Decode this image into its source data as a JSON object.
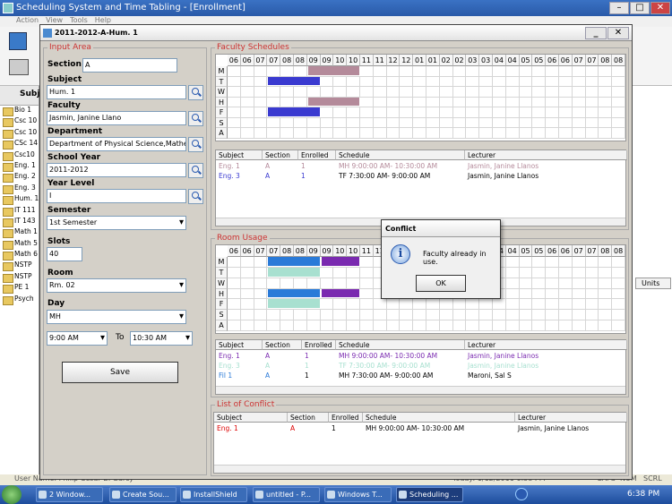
{
  "app": {
    "title": "Scheduling System and Time Tabling - [Enrollment]",
    "menus": [
      "Action",
      "View",
      "Tools",
      "Help"
    ],
    "status_left": "User Name: Philip Cesar B. Garcy",
    "status_right": "Today: 1/12/2011  6:38 PM",
    "caps": "CAPS",
    "num": "NUM",
    "scrl": "SCRL"
  },
  "leftnav": {
    "header": "Subj",
    "items": [
      "Bio 1",
      "Csc 10",
      "Csc 10",
      "CSc 14",
      "Csc10",
      "Eng. 1",
      "Eng. 2",
      "Eng. 3",
      "Hum. 1",
      "IT 111",
      "IT 143",
      "Math 1",
      "Math 5",
      "Math 6",
      "NSTP",
      "NSTP",
      "PE 1",
      "Psych"
    ]
  },
  "right_col_label": "Units",
  "window": {
    "title": "2011-2012-A-Hum. 1"
  },
  "input": {
    "caption": "Input Area",
    "section_label": "Section",
    "section": "A",
    "subject_label": "Subject",
    "subject": "Hum. 1",
    "faculty_label": "Faculty",
    "faculty": "Jasmin, Janine Llano",
    "department_label": "Department",
    "department": "Department of Physical Science,Mathematic",
    "school_year_label": "School Year",
    "school_year": "2011-2012",
    "year_level_label": "Year Level",
    "year_level": "I",
    "semester_label": "Semester",
    "semester": "1st Semester",
    "slots_label": "Slots",
    "slots": "40",
    "room_label": "Room",
    "room": "Rm. 02",
    "day_label": "Day",
    "day": "MH",
    "time_from": "9:00 AM",
    "to_label": "To",
    "time_to": "10:30 AM",
    "save": "Save"
  },
  "faculty_sched": {
    "caption": "Faculty Schedules",
    "hours": [
      "06",
      "06",
      "07",
      "07",
      "08",
      "08",
      "09",
      "09",
      "10",
      "10",
      "11",
      "11",
      "12",
      "12",
      "01",
      "01",
      "02",
      "02",
      "03",
      "03",
      "04",
      "04",
      "05",
      "05",
      "06",
      "06",
      "07",
      "07",
      "08",
      "08"
    ],
    "days": [
      "M",
      "T",
      "W",
      "H",
      "F",
      "S",
      "A"
    ],
    "blocks": [
      {
        "day": 0,
        "from": 6,
        "to": 10,
        "color": "#b48a9a"
      },
      {
        "day": 1,
        "from": 3,
        "to": 7,
        "color": "#3a3ad0"
      },
      {
        "day": 3,
        "from": 6,
        "to": 10,
        "color": "#b48a9a"
      },
      {
        "day": 4,
        "from": 3,
        "to": 7,
        "color": "#3a3ad0"
      }
    ],
    "columns": [
      "Subject",
      "Section",
      "Enrolled",
      "Schedule",
      "Lecturer"
    ],
    "rows": [
      {
        "subject": "Eng. 1",
        "section": "A",
        "enrolled": "1",
        "schedule": "MH 9:00:00 AM- 10:30:00 AM",
        "lecturer": "Jasmin, Janine Llanos",
        "color": "#b48a9a"
      },
      {
        "subject": "Eng. 3",
        "section": "A",
        "enrolled": "1",
        "schedule": "TF 7:30:00 AM- 9:00:00 AM",
        "lecturer": "Jasmin, Janine Llanos",
        "color": "#3a3ad0"
      }
    ]
  },
  "room_usage": {
    "caption": "Room Usage",
    "days": [
      "M",
      "T",
      "W",
      "H",
      "F",
      "S",
      "A"
    ],
    "blocks": [
      {
        "day": 0,
        "from": 3,
        "to": 7,
        "color": "#2a7ad8"
      },
      {
        "day": 0,
        "from": 7,
        "to": 10,
        "color": "#7a2ab0"
      },
      {
        "day": 1,
        "from": 3,
        "to": 7,
        "color": "#a8e0d0"
      },
      {
        "day": 3,
        "from": 3,
        "to": 7,
        "color": "#2a7ad8"
      },
      {
        "day": 3,
        "from": 7,
        "to": 10,
        "color": "#7a2ab0"
      },
      {
        "day": 4,
        "from": 3,
        "to": 7,
        "color": "#a8e0d0"
      }
    ],
    "columns": [
      "Subject",
      "Section",
      "Enrolled",
      "Schedule",
      "Lecturer"
    ],
    "rows": [
      {
        "subject": "Eng. 1",
        "section": "A",
        "enrolled": "1",
        "schedule": "MH 9:00:00 AM- 10:30:00 AM",
        "lecturer": "Jasmin, Janine Llanos",
        "color": "#7a2ab0"
      },
      {
        "subject": "Eng. 3",
        "section": "A",
        "enrolled": "1",
        "schedule": "TF 7:30:00 AM- 9:00:00 AM",
        "lecturer": "Jasmin, Janine Llanos",
        "color": "#a8e0d0"
      },
      {
        "subject": "Fil 1",
        "section": "A",
        "enrolled": "1",
        "schedule": "MH 7:30:00 AM- 9:00:00 AM",
        "lecturer": "Maroni, Sal S",
        "color": "#2a7ad8"
      }
    ]
  },
  "conflicts": {
    "caption": "List of Conflict",
    "columns": [
      "Subject",
      "Section",
      "Enrolled",
      "Schedule",
      "Lecturer"
    ],
    "rows": [
      {
        "subject": "Eng. 1",
        "section": "A",
        "enrolled": "1",
        "schedule": "MH 9:00:00 AM- 10:30:00 AM",
        "lecturer": "Jasmin, Janine Llanos"
      }
    ]
  },
  "dialog": {
    "title": "Conflict",
    "message": "Faculty already in use.",
    "ok": "OK"
  },
  "taskbar": {
    "items": [
      "2 Window...",
      "Create Sou...",
      "InstallShield",
      "untitled - P...",
      "Windows T...",
      "Scheduling ..."
    ],
    "clock": "6:38 PM"
  }
}
